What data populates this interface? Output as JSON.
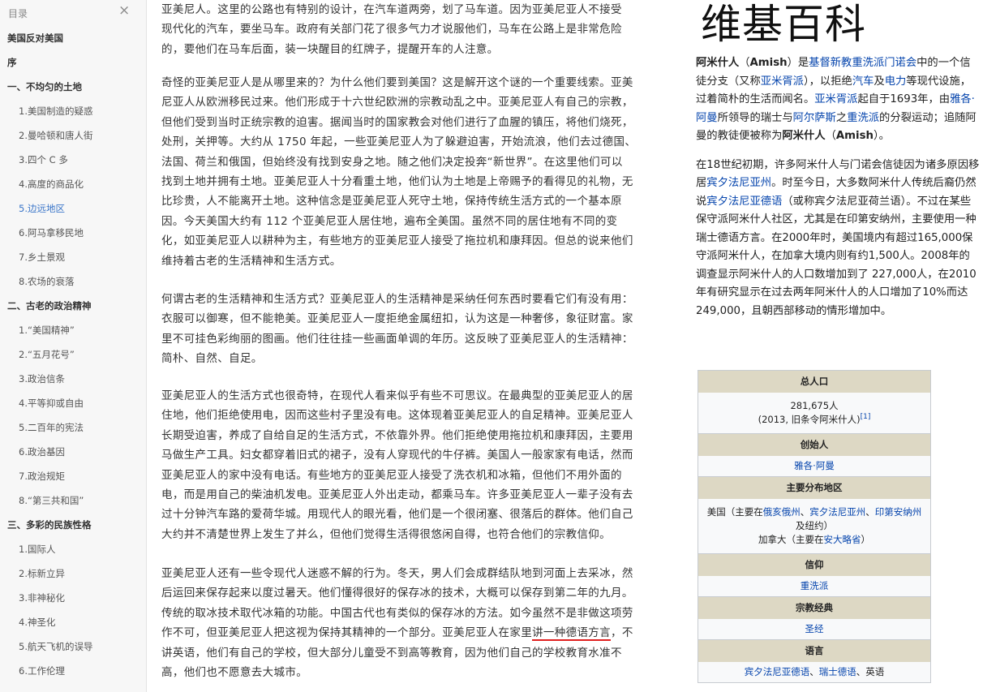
{
  "toc": {
    "title": "目录",
    "close": "×",
    "items": [
      {
        "label": "美国反对美国",
        "level": 1
      },
      {
        "label": "序",
        "level": 1
      },
      {
        "label": "一、不均匀的土地",
        "level": 1
      },
      {
        "label": "1.美国制造的疑惑",
        "level": 2
      },
      {
        "label": "2.曼哈顿和唐人街",
        "level": 2
      },
      {
        "label": "3.四个 C 多",
        "level": 2
      },
      {
        "label": "4.高度的商品化",
        "level": 2
      },
      {
        "label": "5.边远地区",
        "level": 2,
        "active": true
      },
      {
        "label": "6.阿马拿移民地",
        "level": 2
      },
      {
        "label": "7.乡土景观",
        "level": 2
      },
      {
        "label": "8.农场的衰落",
        "level": 2
      },
      {
        "label": "二、古老的政治精神",
        "level": 1
      },
      {
        "label": "1.“美国精神”",
        "level": 2
      },
      {
        "label": "2.“五月花号”",
        "level": 2
      },
      {
        "label": "3.政治信条",
        "level": 2
      },
      {
        "label": "4.平等抑或自由",
        "level": 2
      },
      {
        "label": "5.二百年的宪法",
        "level": 2
      },
      {
        "label": "6.政治基因",
        "level": 2
      },
      {
        "label": "7.政治规矩",
        "level": 2
      },
      {
        "label": "8.“第三共和国”",
        "level": 2
      },
      {
        "label": "三、多彩的民族性格",
        "level": 1
      },
      {
        "label": "1.国际人",
        "level": 2
      },
      {
        "label": "2.标新立异",
        "level": 2
      },
      {
        "label": "3.非神秘化",
        "level": 2
      },
      {
        "label": "4.神圣化",
        "level": 2
      },
      {
        "label": "5.航天飞机的误导",
        "level": 2
      },
      {
        "label": "6.工作伦理",
        "level": 2
      }
    ]
  },
  "article": {
    "paragraphs": [
      {
        "lines": [
          "亚美尼人。这里的公路也有特别的设计，在汽车道两旁，划了马车道。因为亚美尼亚人不接受",
          "现代化的汽车，要坐马车。政府有关部门花了很多气力才说服他们，马车在公路上是非常危险",
          "的，要他们在马车后面，装一块醒目的红牌子，提醒开车的人注意。"
        ]
      },
      {
        "lines": [
          "奇怪的亚美尼亚人是从哪里来的？为什么他们要到美国？这是解开这个谜的一个重要线索。亚美",
          "尼亚人从欧洲移民过来。他们形成于十六世纪欧洲的宗教动乱之中。亚美尼亚人有自己的宗教，",
          "但他们受到当时正统宗教的迫害。据闻当时的国家教会对他们进行了血腥的镇压，将他们烧死，",
          "处刑，关押等。大约从 1750 年起，一些亚美尼亚人为了躲避迫害，开始流浪，他们去过德国、",
          "法国、荷兰和俄国，但始终没有找到安身之地。随之他们决定投奔“新世界”。在这里他们可以",
          "找到土地并拥有土地。亚美尼亚人十分看重土地，他们认为土地是上帝赐予的看得见的礼物，无",
          "比珍贵，人不能离开土地。这种信念是亚美尼亚人死守土地，保持传统生活方式的一个基本原",
          "因。今天美国大约有 112 个亚美尼亚人居住地，遍布全美国。虽然不同的居住地有不同的变",
          "化，如亚美尼亚人以耕种为主，有些地方的亚美尼亚人接受了拖拉机和康拜因。但总的说来他们",
          "维持着古老的生活精神和生活方式。"
        ]
      },
      {
        "lines": [
          "何谓古老的生活精神和生活方式？亚美尼亚人的生活精神是采纳任何东西时要看它们有没有用：",
          "衣服可以御寒，但不能艳美。亚美尼亚人一度拒绝金属纽扣，认为这是一种奢侈，象征财富。家",
          "里不可挂色彩绚丽的图画。他们往往挂一些画面单调的年历。这反映了亚美尼亚人的生活精神：",
          "简朴、自然、自足。"
        ]
      },
      {
        "lines": [
          "亚美尼亚人的生活方式也很奇特，在现代人看来似乎有些不可思议。在最典型的亚美尼亚人的居",
          "住地，他们拒绝使用电，因而这些村子里没有电。这体现着亚美尼亚人的自足精神。亚美尼亚人",
          "长期受迫害，养成了自给自足的生活方式，不依靠外界。他们拒绝使用拖拉机和康拜因，主要用",
          "马做生产工具。妇女都穿着旧式的裙子，没有人穿现代的牛仔裤。美国人一般家家有电话，然而",
          "亚美尼亚人的家中没有电话。有些地方的亚美尼亚人接受了洗衣机和冰箱，但他们不用外面的",
          "电，而是用自己的柴油机发电。亚美尼亚人外出走动，都乘马车。许多亚美尼亚人一辈子没有去",
          "过十分钟汽车路的爱荷华城。用现代人的眼光看，他们是一个很闭塞、很落后的群体。他们自己",
          "大约并不清楚世界上发生了并么，但他们觉得生活得很悠闲自得，也符合他们的宗教信仰。"
        ]
      },
      {
        "lines": [
          "亚美尼亚人还有一些令现代人迷惑不解的行为。冬天，男人们会成群结队地到河面上去采冰，然",
          "后运回来保存起来以度过暑天。他们懂得很好的保存冰的技术，大概可以保存到第二年的九月。",
          "传统的取冰技术取代冰箱的功能。中国古代也有类似的保存冰的方法。如今虽然不是非做这项劳"
        ],
        "special_line": {
          "before": "作不可，但亚美尼亚人把这视为保持其精神的一个部分。亚美尼亚人在家里",
          "underlined": "讲一种德语方言",
          "after": "，不"
        },
        "tail_lines": [
          "讲英语，他们有自己的学校，但大部分儿童受不到高等教育，因为他们自己的学校教育水准不",
          "高，他们也不愿意去大城市。"
        ]
      }
    ]
  },
  "wiki": {
    "logo": "维基百科",
    "p1": {
      "t1": "阿米什人",
      "t2": "（",
      "t3": "Amish",
      "t4": "）是",
      "l1": "基督新教",
      "l2": "重洗派",
      "l3": "门诺会",
      "t5": "中的一个信徒分支（又称",
      "l4": "亚米胥派",
      "t6": "），以拒绝",
      "l5": "汽车",
      "t7": "及",
      "l6": "电力",
      "t8": "等现代设施，过着简朴的生活而闻名。",
      "l7": "亚米胥派",
      "t9": "起自于1693年，由",
      "l8": "雅各·阿曼",
      "t10": "所领导的瑞士与",
      "l9": "阿尔萨斯",
      "t11": "之",
      "l10": "重洗派",
      "t12": "的分裂运动；追随阿曼的教徒便被称为",
      "t13": "阿米什人",
      "t14": "（",
      "t15": "Amish",
      "t16": "）。"
    },
    "p2": {
      "t1": "在18世纪初期，许多阿米什人与门诺会信徒因为诸多原因移居",
      "l1": "宾夕法尼亚州",
      "t2": "。时至今日，大多数阿米什人传统后裔仍然说",
      "l2": "宾夕法尼亚德语",
      "t3": "（或称宾夕法尼亚荷兰语）。不过在某些保守派阿米什人社区，尤其是在印第安纳州，主要使用一种瑞士德语方言。在2000年时，美国境内有超过165,000保守派阿米什人，在加拿大境内则有约1,500人。2008年的调查显示阿米什人的人口数增加到了 227,000人，在2010年有研究显示在过去两年阿米什人的人口增加了10%而达249,000，且朝西部移动的情形增加中。"
    },
    "infobox": {
      "population_head": "总人口",
      "population_value": "281,675人",
      "population_note": "(2013, 旧条令阿米什人)",
      "population_ref": "[1]",
      "founder_head": "创始人",
      "founder_value": "雅各·阿曼",
      "regions_head": "主要分布地区",
      "regions": {
        "r1": "美国（主要在",
        "l1": "俄亥俄州",
        "s1": "、",
        "l2": "宾夕法尼亚州",
        "s2": "、",
        "l3": "印第安纳州",
        "r2": "及纽约）",
        "r3": "加拿大（主要在",
        "l4": "安大略省",
        "r4": "）"
      },
      "belief_head": "信仰",
      "belief_value": "重洗派",
      "scripture_head": "宗教经典",
      "scripture_value": "圣经",
      "language_head": "语言",
      "language": {
        "l1": "宾夕法尼亚德语",
        "s1": "、",
        "l2": "瑞士德语",
        "s2": "、英语"
      }
    }
  }
}
